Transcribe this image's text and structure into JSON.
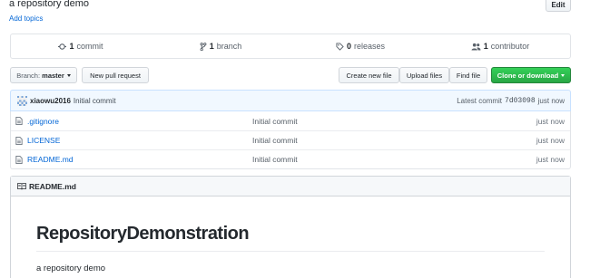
{
  "repo": {
    "description": "a repository demo",
    "add_topics": "Add topics",
    "edit_label": "Edit"
  },
  "summary": {
    "commits_count": "1",
    "commits_label": "commit",
    "branches_count": "1",
    "branches_label": "branch",
    "releases_count": "0",
    "releases_label": "releases",
    "contributors_count": "1",
    "contributors_label": "contributor"
  },
  "toolbar": {
    "branch_prefix": "Branch:",
    "branch_name": "master",
    "new_pull_request": "New pull request",
    "create_new_file": "Create new file",
    "upload_files": "Upload files",
    "find_file": "Find file",
    "clone_or_download": "Clone or download"
  },
  "latest_commit": {
    "author": "xiaowu2016",
    "message": "Initial commit",
    "label": "Latest commit",
    "sha": "7d03098",
    "age": "just now"
  },
  "files": [
    {
      "name": ".gitignore",
      "message": "Initial commit",
      "age": "just now"
    },
    {
      "name": "LICENSE",
      "message": "Initial commit",
      "age": "just now"
    },
    {
      "name": "README.md",
      "message": "Initial commit",
      "age": "just now"
    }
  ],
  "readme": {
    "filename": "README.md",
    "heading": "RepositoryDemonstration",
    "body": "a repository demo"
  },
  "colors": {
    "link": "#0366d6",
    "green_button": "#28a745",
    "commit_bar_bg": "#f1f8ff"
  },
  "icons": [
    "commit-icon",
    "branch-icon",
    "tag-icon",
    "people-icon",
    "file-icon",
    "book-icon",
    "identicon-avatar"
  ]
}
